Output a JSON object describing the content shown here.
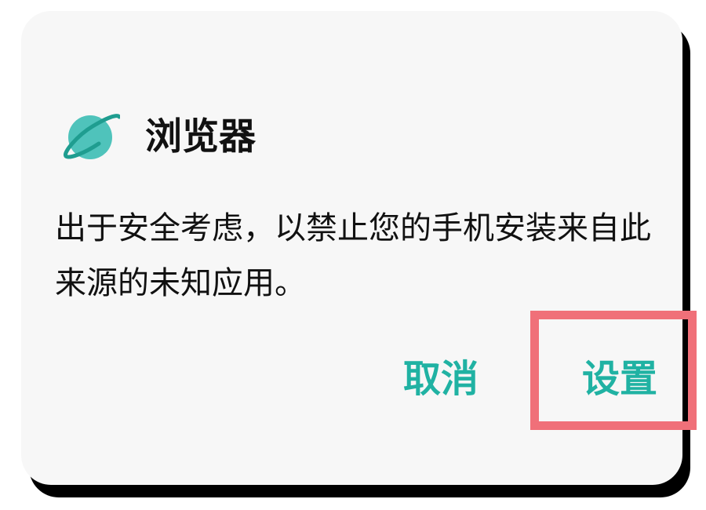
{
  "dialog": {
    "app_icon": "planet-icon",
    "title": "浏览器",
    "message": "出于安全考虑，以禁止您的手机安装来自此来源的未知应用。",
    "buttons": {
      "cancel_label": "取消",
      "settings_label": "设置"
    }
  },
  "colors": {
    "accent": "#20b2a3",
    "icon_fill": "#4fc3bb",
    "icon_ring": "#1f9d90",
    "highlight": "#f07079",
    "dialog_bg": "#f7f7f7"
  }
}
